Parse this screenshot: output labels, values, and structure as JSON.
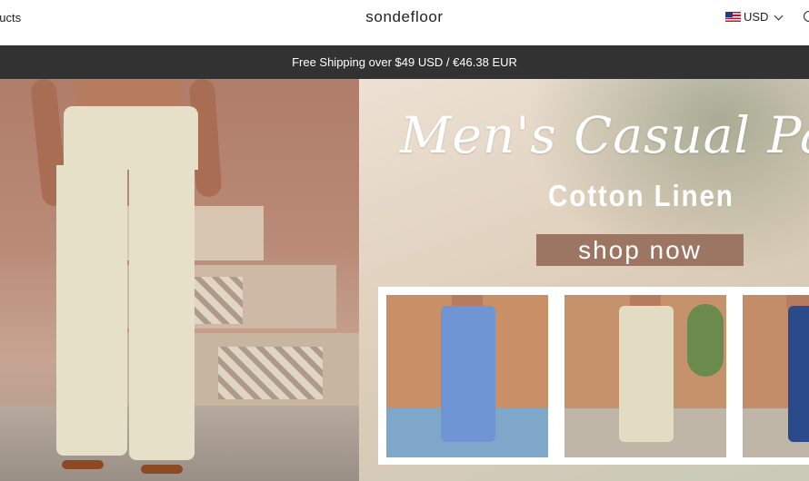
{
  "header": {
    "nav_products": "ducts",
    "logo": "sondefloor",
    "currency": "USD",
    "flag_icon": "us-flag-icon",
    "dropdown_icon": "chevron-down-icon",
    "search_icon": "search-icon"
  },
  "promo": {
    "text": "Free Shipping over $49 USD / €46.38 EUR"
  },
  "hero": {
    "headline": "Men's Casual Pa",
    "subheadline": "Cotton Linen",
    "cta": "shop now"
  },
  "thumbnails": [
    {
      "name": "blue linen pants",
      "color": "#6f95d4"
    },
    {
      "name": "beige linen pants",
      "color": "#e3dcc2"
    },
    {
      "name": "navy linen pants",
      "color": "#2a4a8c"
    }
  ],
  "colors": {
    "promo_bg": "#323232",
    "cta_bg": "#9c7663"
  }
}
